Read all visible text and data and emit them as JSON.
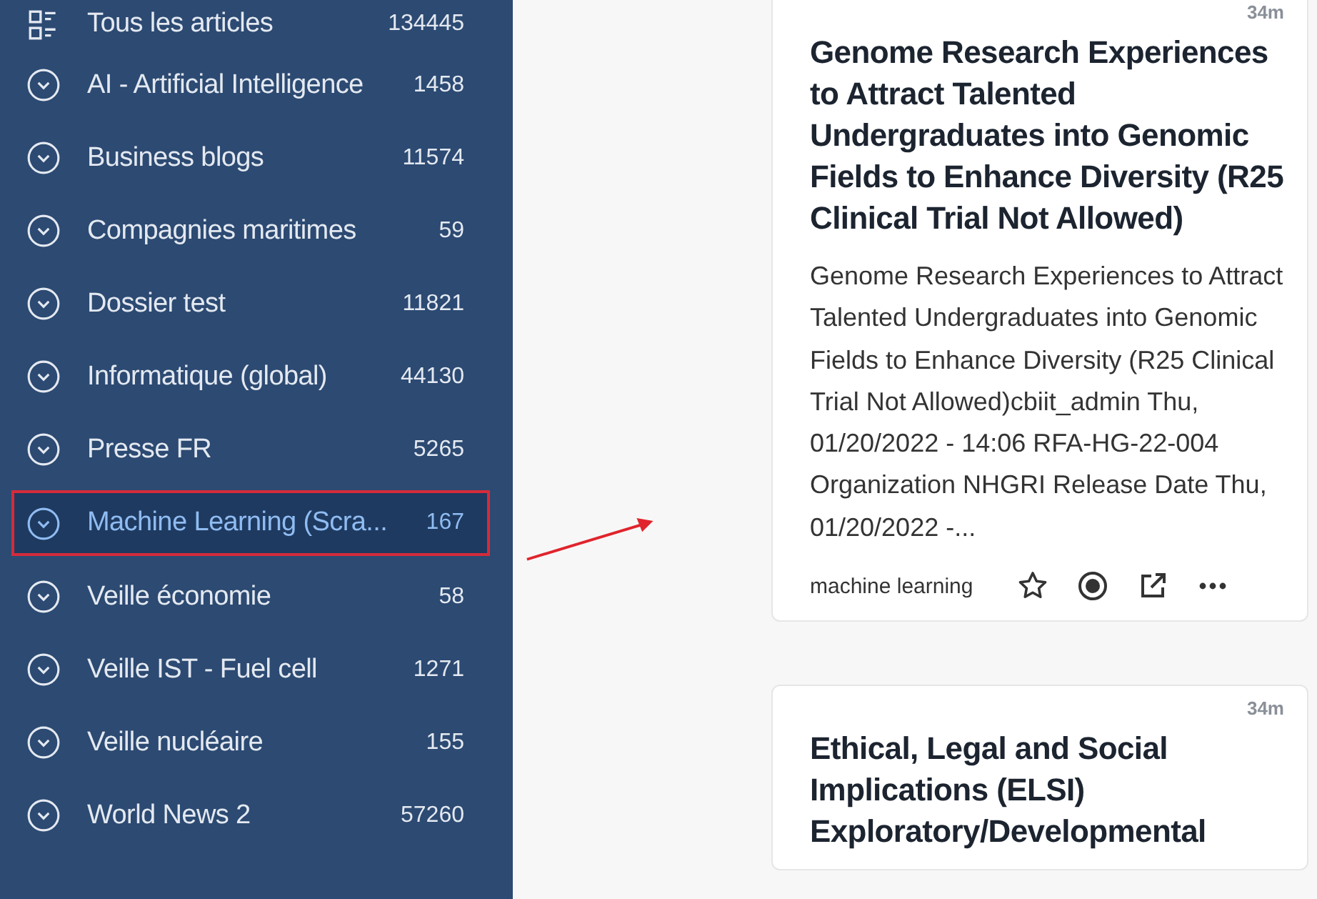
{
  "sidebar": {
    "items": [
      {
        "kind": "all",
        "label": "Tous les articles",
        "count": "134445",
        "selected": false
      },
      {
        "kind": "folder",
        "label": "AI - Artificial Intelligence",
        "count": "1458",
        "selected": false
      },
      {
        "kind": "folder",
        "label": "Business blogs",
        "count": "11574",
        "selected": false
      },
      {
        "kind": "folder",
        "label": "Compagnies maritimes",
        "count": "59",
        "selected": false
      },
      {
        "kind": "folder",
        "label": "Dossier test",
        "count": "11821",
        "selected": false
      },
      {
        "kind": "folder",
        "label": "Informatique (global)",
        "count": "44130",
        "selected": false
      },
      {
        "kind": "folder",
        "label": "Presse FR",
        "count": "5265",
        "selected": false
      },
      {
        "kind": "folder",
        "label": "Machine Learning (Scra...",
        "count": "167",
        "selected": true
      },
      {
        "kind": "folder",
        "label": "Veille économie",
        "count": "58",
        "selected": false
      },
      {
        "kind": "folder",
        "label": "Veille IST - Fuel cell",
        "count": "1271",
        "selected": false
      },
      {
        "kind": "folder",
        "label": "Veille nucléaire",
        "count": "155",
        "selected": false
      },
      {
        "kind": "folder",
        "label": "World News 2",
        "count": "57260",
        "selected": false
      }
    ]
  },
  "articles": [
    {
      "time": "34m",
      "title": "Genome Research Experiences to Attract Talented Undergraduates into Genomic Fields to Enhance Diversity (R25 Clinical Trial Not Allowed)",
      "summary": "Genome Research Experiences to Attract Talented Undergraduates into Genomic Fields to Enhance Diversity (R25 Clinical Trial Not Allowed)cbiit_admin Thu, 01/20/2022 - 14:06 RFA-HG-22-004 Organization NHGRI Release Date Thu, 01/20/2022 -...",
      "tag": "machine learning"
    },
    {
      "time": "34m",
      "title": "Ethical, Legal and Social Implications (ELSI) Exploratory/Developmental"
    }
  ]
}
